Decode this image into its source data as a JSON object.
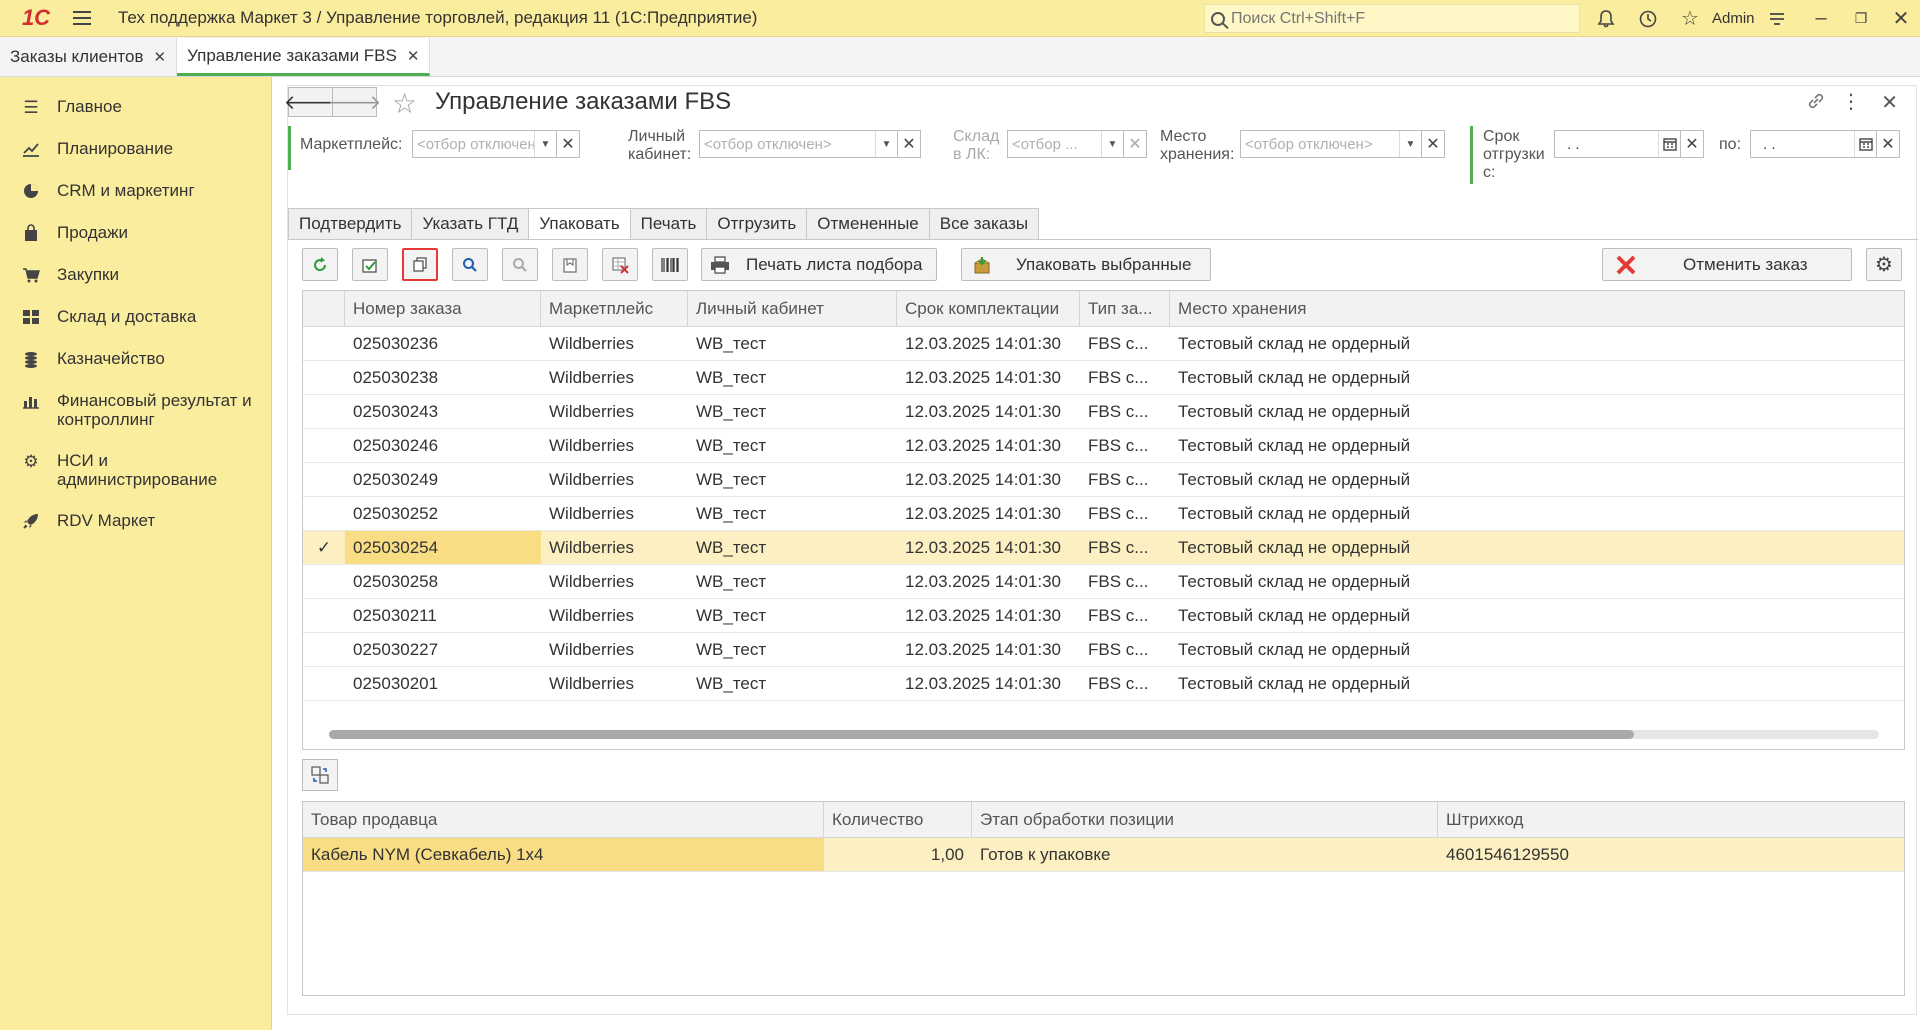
{
  "app": {
    "title": "Тех поддержка Маркет 3 / Управление торговлей, редакция 11  (1С:Предприятие)",
    "logo": "1С",
    "search_placeholder": "Поиск Ctrl+Shift+F",
    "user": "Admin"
  },
  "doc_tabs": [
    {
      "label": "Заказы клиентов"
    },
    {
      "label": "Управление заказами FBS"
    }
  ],
  "sidebar": {
    "items": [
      {
        "label": "Главное",
        "icon": "menu-icon"
      },
      {
        "label": "Планирование",
        "icon": "chart-icon"
      },
      {
        "label": "CRM и маркетинг",
        "icon": "pie-icon"
      },
      {
        "label": "Продажи",
        "icon": "bag-icon"
      },
      {
        "label": "Закупки",
        "icon": "cart-icon"
      },
      {
        "label": "Склад и доставка",
        "icon": "grid-icon"
      },
      {
        "label": "Казначейство",
        "icon": "coins-icon"
      },
      {
        "label": "Финансовый результат и контроллинг",
        "icon": "bar-chart-icon"
      },
      {
        "label": "НСИ и администрирование",
        "icon": "gear-icon"
      },
      {
        "label": "RDV Маркет",
        "icon": "rocket-icon"
      }
    ]
  },
  "form": {
    "title": "Управление заказами FBS",
    "filters": {
      "marketplace_label": "Маркетплейс:",
      "marketplace_value": "<отбор отключен>",
      "cabinet_label": "Личный кабинет:",
      "cabinet_value": "<отбор отключен>",
      "warehouse_label": "Склад в ЛК:",
      "warehouse_value": "<отбор ...",
      "storage_label": "Место хранения:",
      "storage_value": "<отбор отключен>",
      "ship_from_label": "Срок отгрузки с:",
      "ship_from_value": " .  .",
      "ship_to_label": "по:",
      "ship_to_value": " .  ."
    },
    "op_tabs": [
      {
        "label": "Подтвердить"
      },
      {
        "label": "Указать ГТД"
      },
      {
        "label": "Упаковать"
      },
      {
        "label": "Печать"
      },
      {
        "label": "Отгрузить"
      },
      {
        "label": "Отмененные"
      },
      {
        "label": "Все заказы"
      }
    ],
    "toolbar": {
      "print_label": "Печать листа подбора",
      "pack_label": "Упаковать выбранные",
      "cancel_label": "Отменить заказ"
    },
    "orders": {
      "columns": [
        "Номер заказа",
        "Маркетплейс",
        "Личный кабинет",
        "Срок комплектации",
        "Тип за...",
        "Место хранения"
      ],
      "rows": [
        {
          "checked": "",
          "number": "025030236",
          "mp": "Wildberries",
          "cabinet": "WB_тест",
          "due": "12.03.2025 14:01:30",
          "type": "FBS с...",
          "storage": "Тестовый склад не ордерный"
        },
        {
          "checked": "",
          "number": "025030238",
          "mp": "Wildberries",
          "cabinet": "WB_тест",
          "due": "12.03.2025 14:01:30",
          "type": "FBS с...",
          "storage": "Тестовый склад не ордерный"
        },
        {
          "checked": "",
          "number": "025030243",
          "mp": "Wildberries",
          "cabinet": "WB_тест",
          "due": "12.03.2025 14:01:30",
          "type": "FBS с...",
          "storage": "Тестовый склад не ордерный"
        },
        {
          "checked": "",
          "number": "025030246",
          "mp": "Wildberries",
          "cabinet": "WB_тест",
          "due": "12.03.2025 14:01:30",
          "type": "FBS с...",
          "storage": "Тестовый склад не ордерный"
        },
        {
          "checked": "",
          "number": "025030249",
          "mp": "Wildberries",
          "cabinet": "WB_тест",
          "due": "12.03.2025 14:01:30",
          "type": "FBS с...",
          "storage": "Тестовый склад не ордерный"
        },
        {
          "checked": "",
          "number": "025030252",
          "mp": "Wildberries",
          "cabinet": "WB_тест",
          "due": "12.03.2025 14:01:30",
          "type": "FBS с...",
          "storage": "Тестовый склад не ордерный"
        },
        {
          "checked": "✓",
          "number": "025030254",
          "mp": "Wildberries",
          "cabinet": "WB_тест",
          "due": "12.03.2025 14:01:30",
          "type": "FBS с...",
          "storage": "Тестовый склад не ордерный"
        },
        {
          "checked": "",
          "number": "025030258",
          "mp": "Wildberries",
          "cabinet": "WB_тест",
          "due": "12.03.2025 14:01:30",
          "type": "FBS с...",
          "storage": "Тестовый склад не ордерный"
        },
        {
          "checked": "",
          "number": "025030211",
          "mp": "Wildberries",
          "cabinet": "WB_тест",
          "due": "12.03.2025 14:01:30",
          "type": "FBS с...",
          "storage": "Тестовый склад не ордерный"
        },
        {
          "checked": "",
          "number": "025030227",
          "mp": "Wildberries",
          "cabinet": "WB_тест",
          "due": "12.03.2025 14:01:30",
          "type": "FBS с...",
          "storage": "Тестовый склад не ордерный"
        },
        {
          "checked": "",
          "number": "025030201",
          "mp": "Wildberries",
          "cabinet": "WB_тест",
          "due": "12.03.2025 14:01:30",
          "type": "FBS с...",
          "storage": "Тестовый склад не ордерный"
        }
      ],
      "selected_row": 6
    },
    "items": {
      "columns": [
        "Товар продавца",
        "Количество",
        "Этап обработки позиции",
        "Штрихкод"
      ],
      "rows": [
        {
          "product": "Кабель NYM (Севкабель) 1х4",
          "qty": "1,00",
          "stage": "Готов к упаковке",
          "barcode": "4601546129550"
        }
      ]
    }
  },
  "colors": {
    "sidebar_bg": "#fbed9e",
    "accent_green": "#4caf50",
    "selected_row": "#fcf0c2",
    "highlight_border": "#e53935"
  }
}
